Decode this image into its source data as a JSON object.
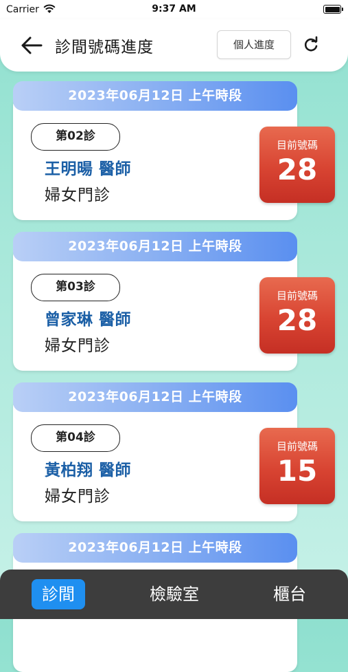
{
  "status_bar": {
    "carrier": "Carrier",
    "time": "9:37 AM"
  },
  "header": {
    "title": "診間號碼進度",
    "personal_button": "個人進度"
  },
  "cards": [
    {
      "session": "2023年06月12日 上午時段",
      "room": "第02診",
      "doctor": "王明暘 醫師",
      "department": "婦女門診",
      "badge_label": "目前號碼",
      "current_number": "28"
    },
    {
      "session": "2023年06月12日 上午時段",
      "room": "第03診",
      "doctor": "曾家琳 醫師",
      "department": "婦女門診",
      "badge_label": "目前號碼",
      "current_number": "28"
    },
    {
      "session": "2023年06月12日 上午時段",
      "room": "第04診",
      "doctor": "黃柏翔 醫師",
      "department": "婦女門診",
      "badge_label": "目前號碼",
      "current_number": "15"
    },
    {
      "session": "2023年06月12日 上午時段"
    }
  ],
  "tabs": [
    {
      "label": "診間",
      "active": true
    },
    {
      "label": "檢驗室",
      "active": false
    },
    {
      "label": "櫃台",
      "active": false
    }
  ],
  "colors": {
    "accent": "#1f8ff0",
    "badge": "#d84432",
    "doctor_name": "#1b5fa6",
    "tabbar": "#3d3d3d"
  }
}
